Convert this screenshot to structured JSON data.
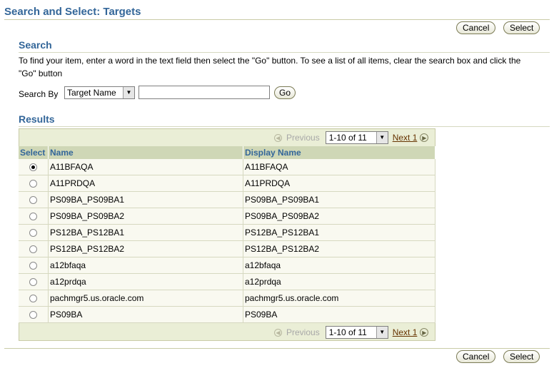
{
  "page": {
    "title": "Search and Select: Targets",
    "cancel_label": "Cancel",
    "select_label": "Select"
  },
  "search": {
    "heading": "Search",
    "instructions": "To find your item, enter a word in the text field then select the \"Go\" button. To see a list of all items, clear the search box and click the \"Go\" button",
    "search_by_label": "Search By",
    "search_by_value": "Target Name",
    "input_value": "",
    "go_label": "Go"
  },
  "results": {
    "heading": "Results",
    "previous_label": "Previous",
    "range_value": "1-10 of 11",
    "next_label": "Next 1",
    "columns": {
      "select": "Select",
      "name": "Name",
      "display_name": "Display Name"
    },
    "rows": [
      {
        "name": "A11BFAQA",
        "display_name": "A11BFAQA",
        "selected": true
      },
      {
        "name": "A11PRDQA",
        "display_name": "A11PRDQA",
        "selected": false
      },
      {
        "name": "PS09BA_PS09BA1",
        "display_name": "PS09BA_PS09BA1",
        "selected": false
      },
      {
        "name": "PS09BA_PS09BA2",
        "display_name": "PS09BA_PS09BA2",
        "selected": false
      },
      {
        "name": "PS12BA_PS12BA1",
        "display_name": "PS12BA_PS12BA1",
        "selected": false
      },
      {
        "name": "PS12BA_PS12BA2",
        "display_name": "PS12BA_PS12BA2",
        "selected": false
      },
      {
        "name": "a12bfaqa",
        "display_name": "a12bfaqa",
        "selected": false
      },
      {
        "name": "a12prdqa",
        "display_name": "a12prdqa",
        "selected": false
      },
      {
        "name": "pachmgr5.us.oracle.com",
        "display_name": "pachmgr5.us.oracle.com",
        "selected": false
      },
      {
        "name": "PS09BA",
        "display_name": "PS09BA",
        "selected": false
      }
    ]
  }
}
